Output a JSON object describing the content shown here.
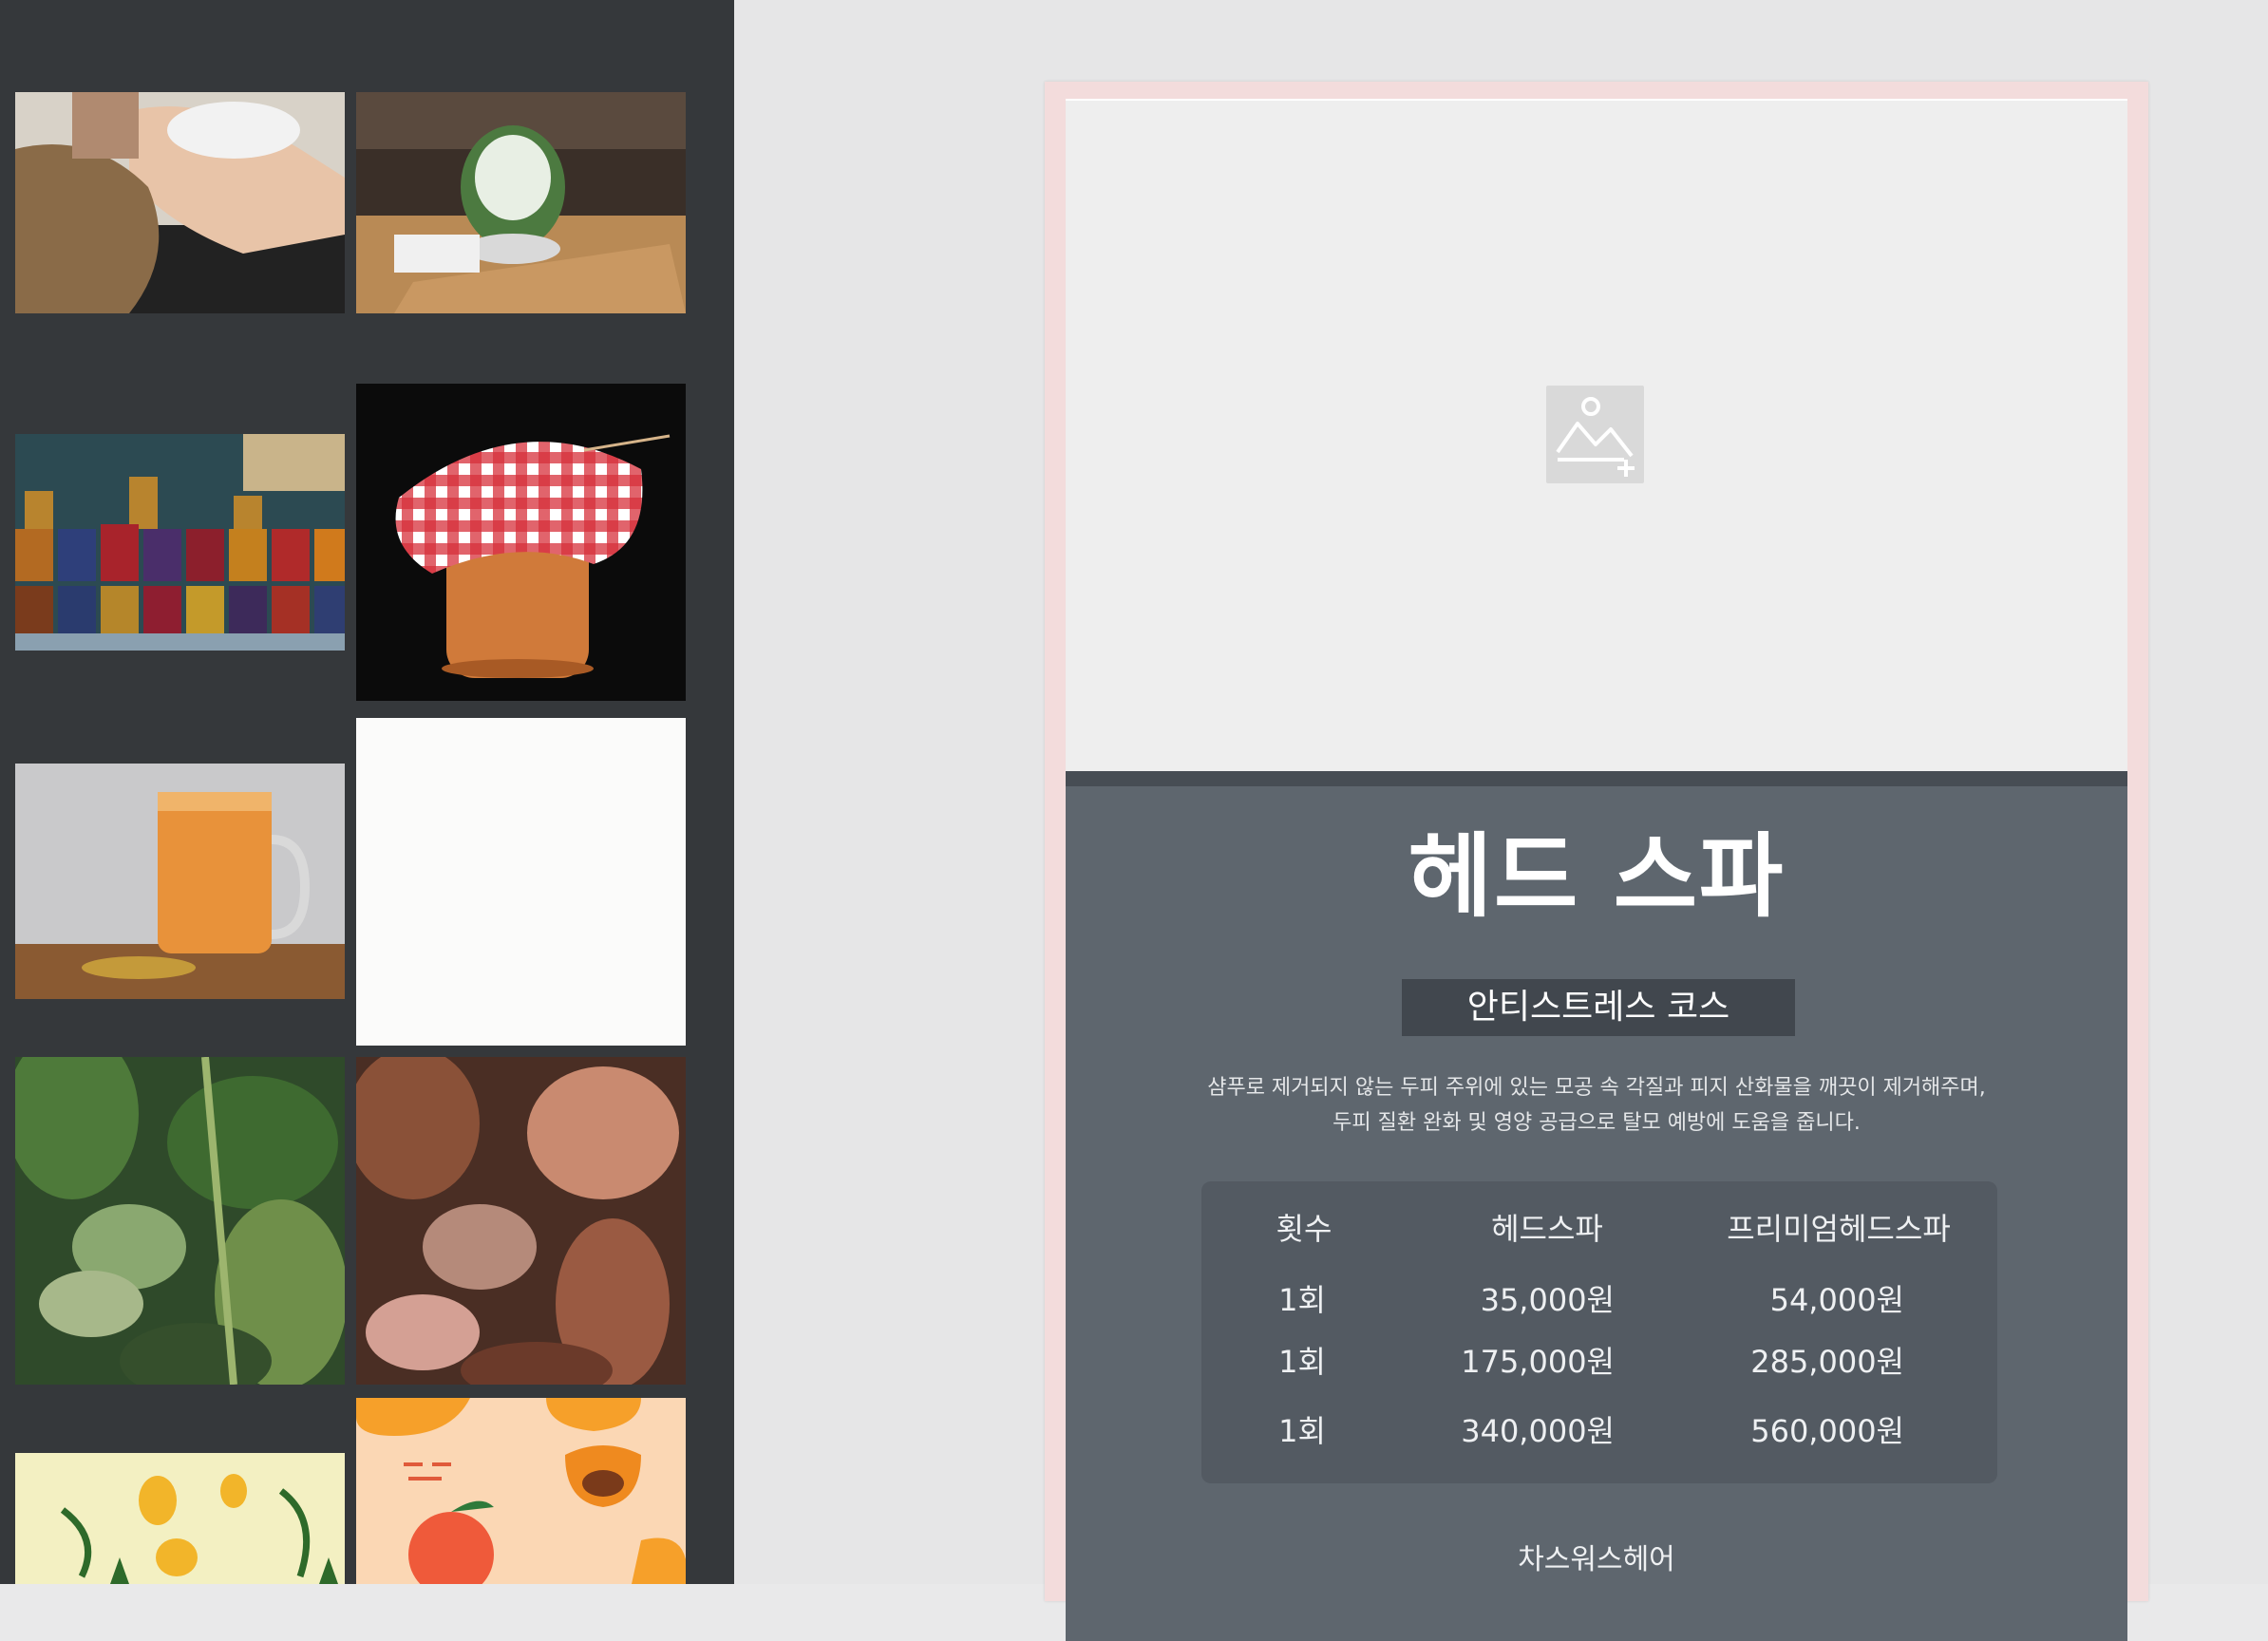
{
  "sidebar": {
    "images": [
      {
        "name": "hair-wash-photo"
      },
      {
        "name": "bingsu-dessert-photo"
      },
      {
        "name": "jam-jars-shelf-photo"
      },
      {
        "name": "gingham-jam-jar-photo"
      },
      {
        "name": "smoothie-mason-jar-photo"
      },
      {
        "name": "blank-white-image"
      },
      {
        "name": "green-leaves-pattern"
      },
      {
        "name": "brown-leaves-pattern"
      },
      {
        "name": "pineapple-pattern"
      },
      {
        "name": "peach-fruit-pattern"
      }
    ]
  },
  "card": {
    "placeholder_icon": "add-image-icon",
    "title": "헤드 스파",
    "subtitle": "안티스트레스 코스",
    "description_line1": "샴푸로 제거되지 않는 두피 주위에 있는 모공 속 각질과 피지 산화물을 깨끗이 제거해주며,",
    "description_line2": "두피 질환 완화 및 영양 공급으로 탈모 예방에 도움을 줍니다.",
    "table": {
      "headers": [
        "횟수",
        "헤드스파",
        "프리미엄헤드스파"
      ],
      "rows": [
        [
          "1회",
          "35,000원",
          "54,000원"
        ],
        [
          "1회",
          "175,000원",
          "285,000원"
        ],
        [
          "1회",
          "340,000원",
          "560,000원"
        ]
      ]
    },
    "shop_name": "차스워스헤어"
  },
  "colors": {
    "sidebar_bg": "#35383b",
    "canvas_bg": "#e6e6e7",
    "card_border": "#f3dcdc",
    "section_bg": "#5e666e",
    "badge_bg": "#41474e",
    "table_bg": "#535a62"
  }
}
